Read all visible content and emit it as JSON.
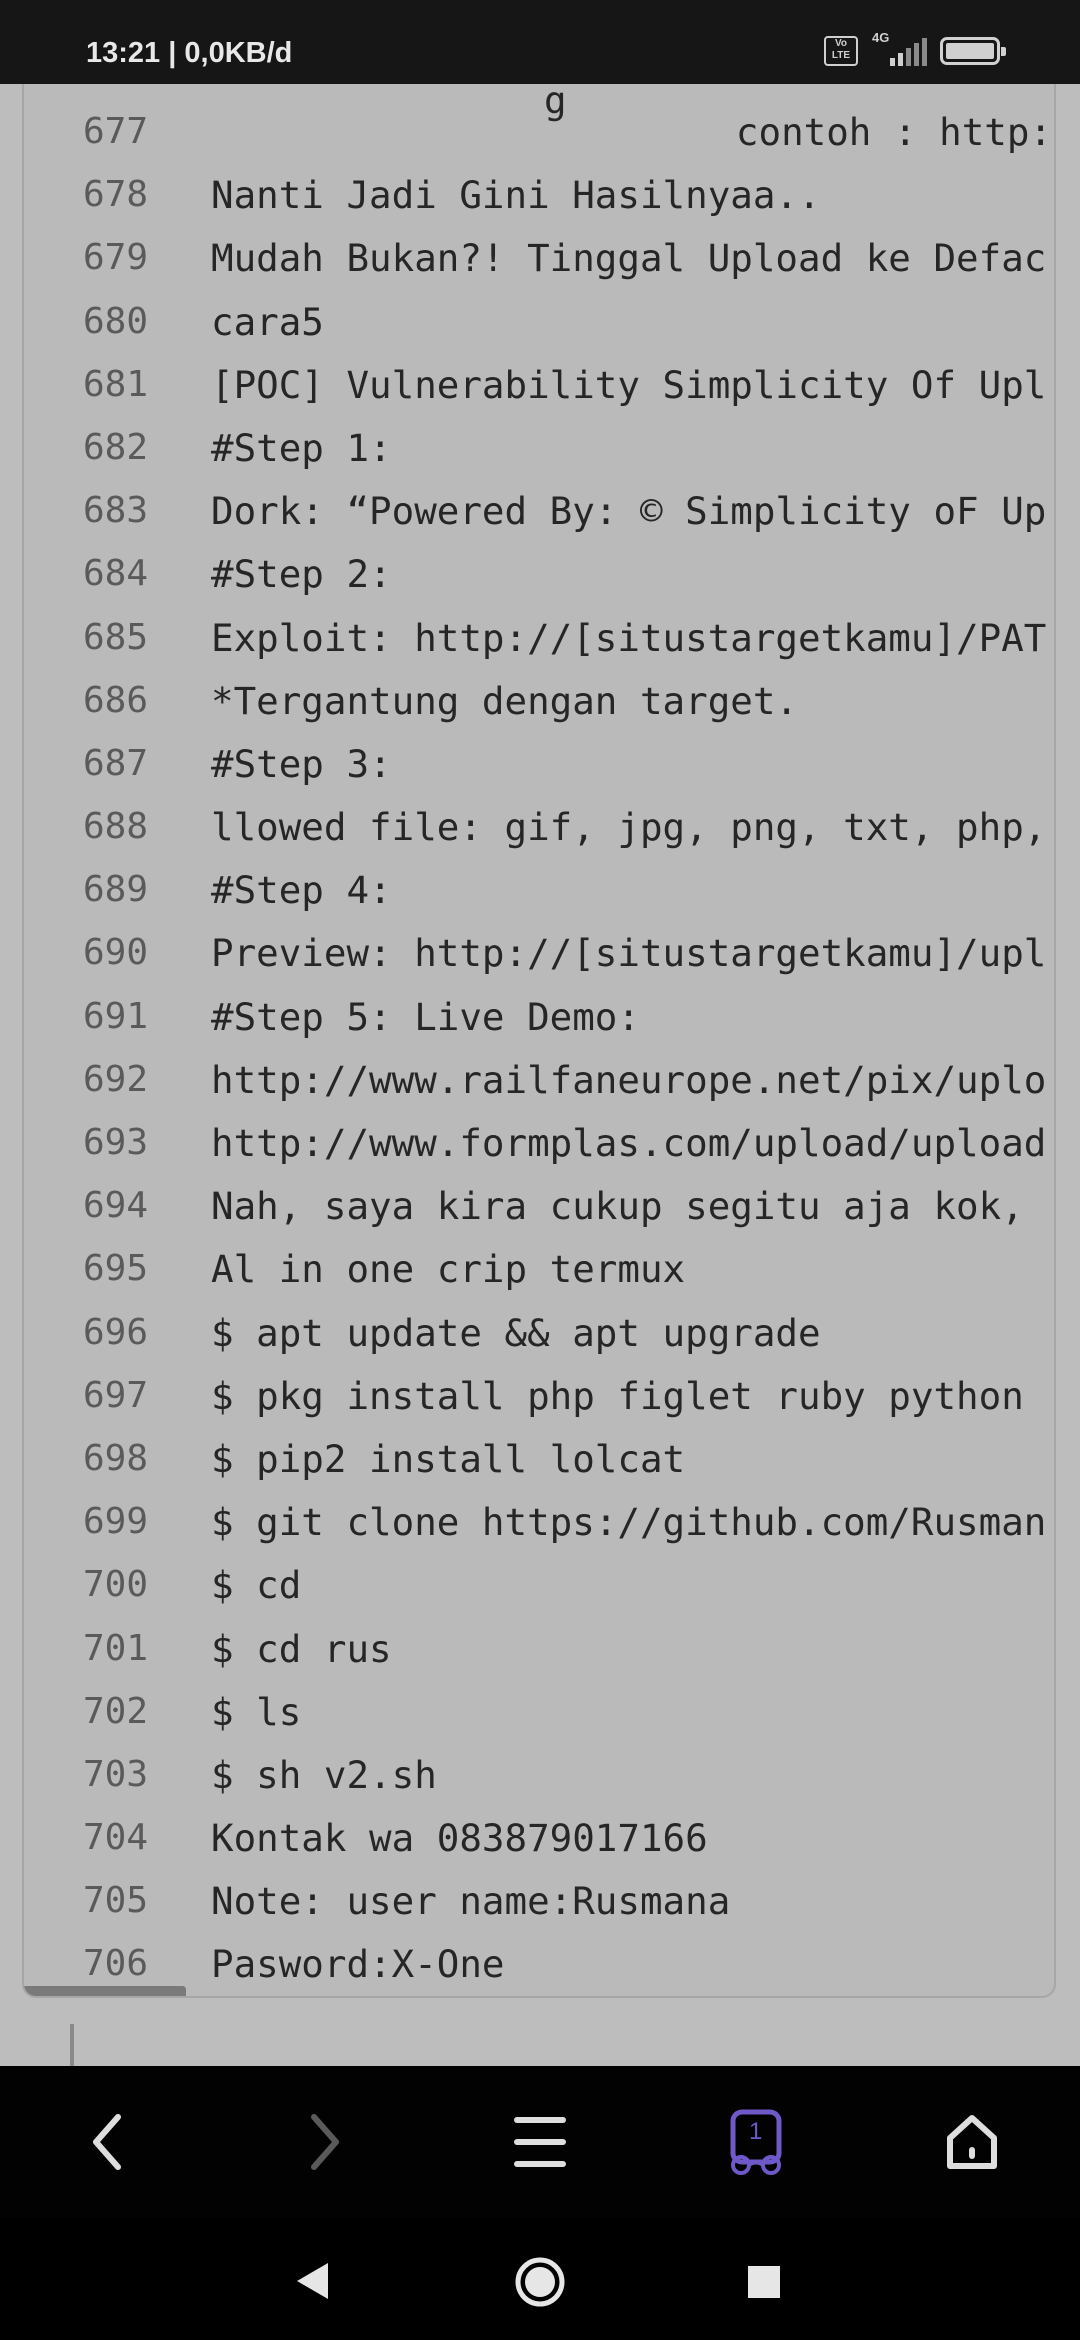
{
  "status": {
    "time": "13:21 | 0,0KB/d",
    "volte": "Vo LTE",
    "network": "4G",
    "battery_level": 100
  },
  "code": {
    "partial_top": "g",
    "lines": [
      {
        "num": "677",
        "text": "contoh : http:",
        "align": "right"
      },
      {
        "num": "678",
        "text": "Nanti Jadi Gini Hasilnyaa.."
      },
      {
        "num": "679",
        "text": "Mudah Bukan?! Tinggal Upload ke Defac"
      },
      {
        "num": "680",
        "text": "cara5"
      },
      {
        "num": "681",
        "text": "[POC] Vulnerability Simplicity Of Upl"
      },
      {
        "num": "682",
        "text": "#Step 1:"
      },
      {
        "num": "683",
        "text": "Dork: “Powered By: © Simplicity oF Up"
      },
      {
        "num": "684",
        "text": "#Step 2:"
      },
      {
        "num": "685",
        "text": "Exploit: http://[situstargetkamu]/PAT"
      },
      {
        "num": "686",
        "text": "*Tergantung dengan target."
      },
      {
        "num": "687",
        "text": "#Step 3:"
      },
      {
        "num": "688",
        "text": "llowed file: gif, jpg, png, txt, php,"
      },
      {
        "num": "689",
        "text": "#Step 4:"
      },
      {
        "num": "690",
        "text": "Preview: http://[situstargetkamu]/upl"
      },
      {
        "num": "691",
        "text": "#Step 5: Live Demo:"
      },
      {
        "num": "692",
        "text": "http://www.railfaneurope.net/pix/uplo"
      },
      {
        "num": "693",
        "text": "http://www.formplas.com/upload/upload"
      },
      {
        "num": "694",
        "text": "Nah, saya kira cukup segitu aja kok,"
      },
      {
        "num": "695",
        "text": "Al in one crip termux"
      },
      {
        "num": "696",
        "text": "$ apt update && apt upgrade"
      },
      {
        "num": "697",
        "text": "$ pkg install php figlet ruby python"
      },
      {
        "num": "698",
        "text": "$ pip2 install lolcat"
      },
      {
        "num": "699",
        "text": "$ git clone https://github.com/Rusman"
      },
      {
        "num": "700",
        "text": "$ cd"
      },
      {
        "num": "701",
        "text": "$ cd rus"
      },
      {
        "num": "702",
        "text": "$ ls"
      },
      {
        "num": "703",
        "text": "$ sh v2.sh"
      },
      {
        "num": "704",
        "text": "Kontak wa 083879017166"
      },
      {
        "num": "705",
        "text": "Note: user name:Rusmana"
      },
      {
        "num": "706",
        "text": "Pasword:X-One"
      }
    ]
  },
  "browser": {
    "tab_count": "1",
    "icons": [
      "back-icon",
      "forward-icon",
      "menu-icon",
      "tabs-icon",
      "home-icon"
    ],
    "accent": "#6f58c8"
  },
  "system_nav": {
    "icons": [
      "back-triangle-icon",
      "home-circle-icon",
      "recents-square-icon"
    ]
  }
}
